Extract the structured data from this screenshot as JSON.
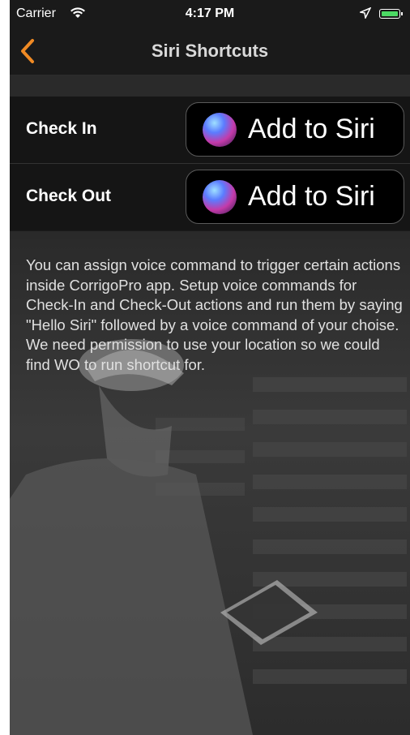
{
  "status_bar": {
    "carrier": "Carrier",
    "time": "4:17 PM",
    "wifi_icon": "wifi-icon",
    "location_icon": "location-arrow-icon",
    "battery_color": "#4cd964"
  },
  "nav": {
    "title": "Siri Shortcuts",
    "back_icon": "chevron-left-icon",
    "accent_color": "#f08a24"
  },
  "shortcuts": [
    {
      "label": "Check In",
      "button_label": "Add to Siri"
    },
    {
      "label": "Check Out",
      "button_label": "Add to Siri"
    }
  ],
  "description": "You can assign voice command to trigger certain actions inside CorrigoPro app. Setup voice commands for Check-In and Check-Out actions and run them by saying \"Hello Siri\" followed by a voice command of your choise. We need permission to use your location so we could find WO to run shortcut for."
}
